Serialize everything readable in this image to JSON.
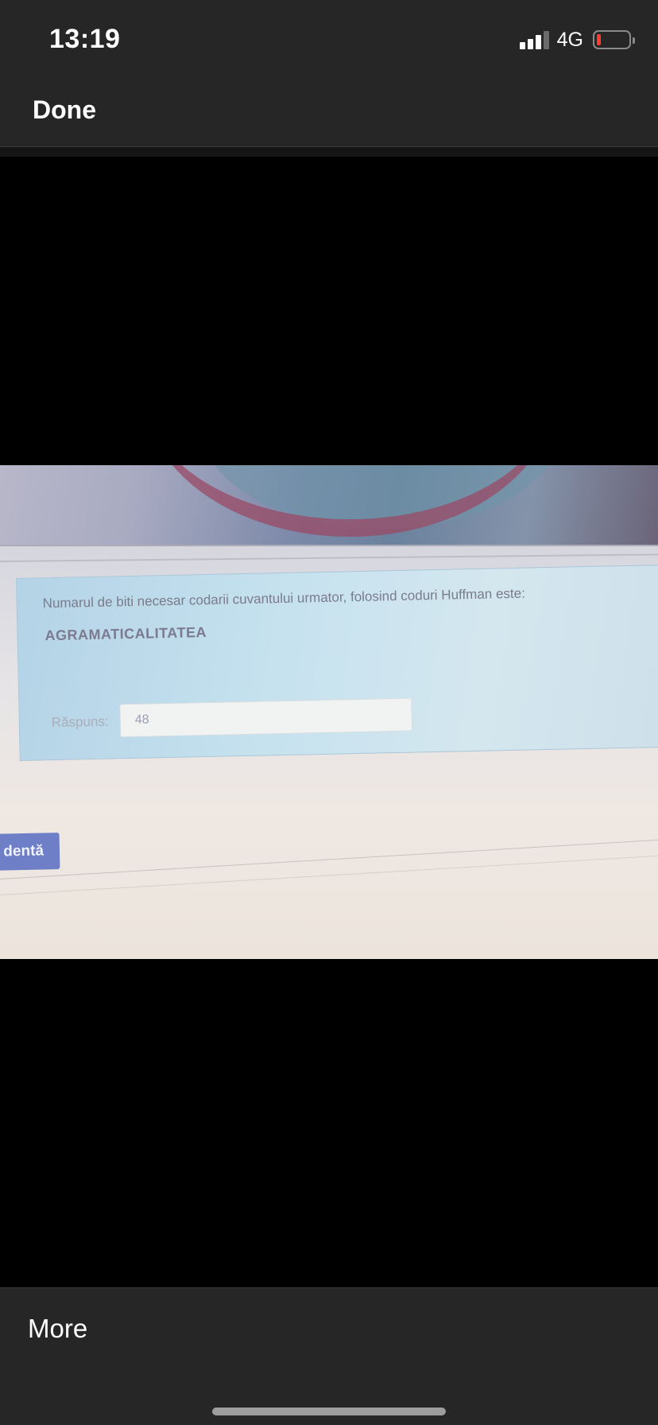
{
  "status_bar": {
    "time": "13:19",
    "network": "4G",
    "signal_bars_active": 3,
    "signal_bars_total": 4,
    "battery_color": "#ff3b30"
  },
  "nav": {
    "done_label": "Done"
  },
  "photo": {
    "question": "Numarul de biti necesar codarii cuvantului urmator, folosind coduri Huffman este:",
    "word": "AGRAMATICALITATEA",
    "answer_label": "Răspuns:",
    "answer_value": "48",
    "previous_button_label": "dentă"
  },
  "bottom_bar": {
    "more_label": "More"
  }
}
